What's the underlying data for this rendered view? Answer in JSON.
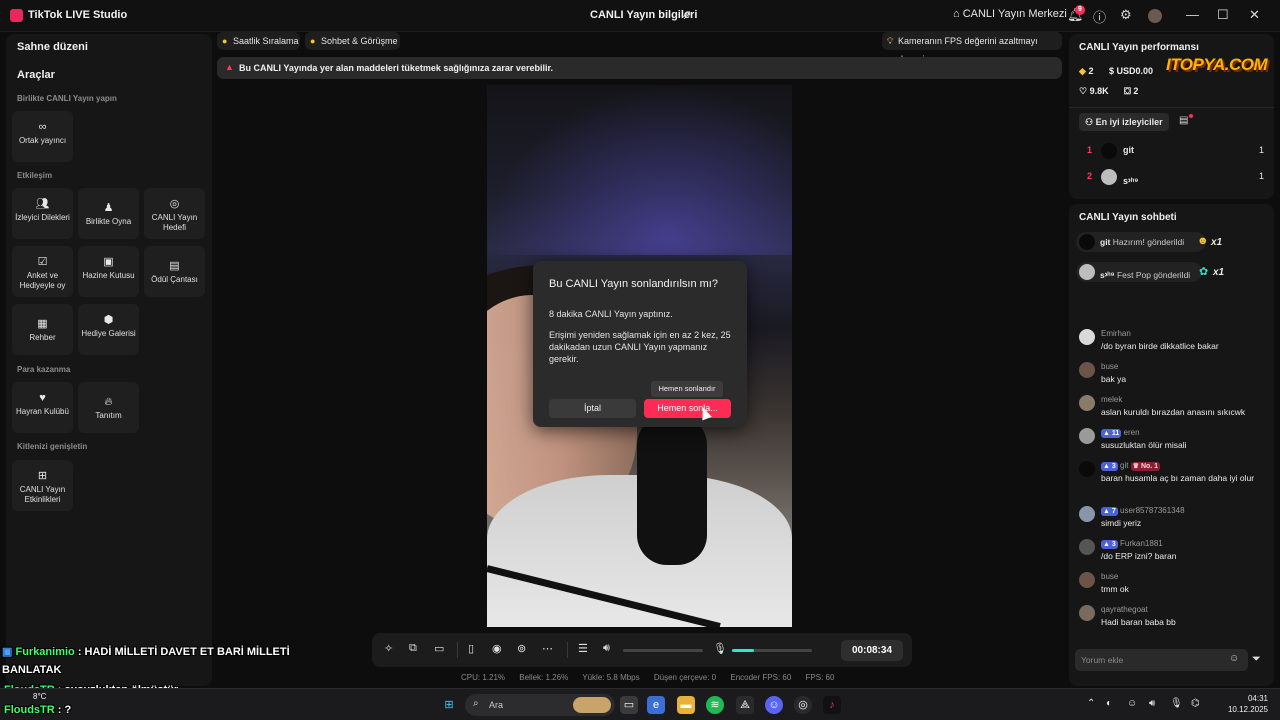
{
  "titlebar": {
    "app_name": "TikTok LIVE Studio",
    "center_title": "CANLI Yayın bilgileri",
    "center_link": "CANLI Yayın Merkezi",
    "notif_count": "9"
  },
  "left_panel": {
    "scene_title": "Sahne düzeni",
    "tools_title": "Araçlar",
    "sections": {
      "collab": "Birlikte CANLI Yayın yapın",
      "interaction": "Etkileşim",
      "monetize": "Para kazanma",
      "audience": "Kitlenizi genişletin"
    },
    "tools": {
      "cohost": "Ortak yayıncı",
      "viewer_requests": "İzleyici Dilekleri",
      "play_together": "Birlikte Oyna",
      "live_goal": "CANLI Yayın Hedefi",
      "poll": "Anket ve Hediyeyle oy",
      "treasure_box": "Hazine Kutusu",
      "reward_bag": "Ödül Çantası",
      "guide": "Rehber",
      "gift_gallery": "Hediye Galerisi",
      "fan_club": "Hayran Kulübü",
      "promotion": "Tanıtım",
      "live_events": "CANLI Yayın Etkinlikleri"
    }
  },
  "center": {
    "chip_ranking": "Saatlik Sıralama",
    "chip_chat": "Sohbet & Görüşme",
    "chip_fps": "Kameranın FPS değerini azaltmayı deneyin",
    "warning": "Bu CANLI Yayında yer alan maddeleri tüketmek sağlığınıza zarar verebilir."
  },
  "modal": {
    "title": "Bu CANLI Yayın sonlandırılsın mı?",
    "line1": "8 dakika CANLI Yayın yaptınız.",
    "line2": "Erişimi yeniden sağlamak için en az 2 kez, 25 dakikadan uzun CANLI Yayın yapmanız gerekir.",
    "cancel": "İptal",
    "end": "Hemen sonla...",
    "tooltip": "Hemen sonlandır"
  },
  "toolbar": {
    "timer": "00:08:34",
    "volume_level": 0.0,
    "mic_level": 0.28
  },
  "stats": {
    "cpu": "CPU:  1.21%",
    "memory": "Bellek:  1.26%",
    "upload": "Yükle:  5.8 Mbps",
    "dropped": "Düşen çerçeve:  0",
    "encoder_fps": "Encoder FPS:  60",
    "fps": "FPS:  60"
  },
  "performance": {
    "title": "CANLI Yayın performansı",
    "diamonds": "2",
    "usd": "USD0.00",
    "likes": "9.8K",
    "gifts": "2",
    "top_viewers_label": "En iyi izleyiciler",
    "ranking": [
      {
        "rank": "1",
        "name": "git",
        "count": "1"
      },
      {
        "rank": "2",
        "name": "s᠈ʰ⁹",
        "count": "1"
      }
    ]
  },
  "watermark": "ITOPYA.COM",
  "chat": {
    "title": "CANLI Yayın sohbeti",
    "gifts": [
      {
        "user": "git",
        "text": "Hazırım! gönderildi",
        "mult": "x1"
      },
      {
        "user": "s᠈ʰ⁹",
        "text": "Fest Pop gönderildi",
        "mult": "x1"
      }
    ],
    "messages": [
      {
        "user": "Emirhan",
        "level": "",
        "text": "/do byran birde dikkatlice bakar"
      },
      {
        "user": "buse",
        "level": "",
        "text": "bak ya"
      },
      {
        "user": "melek",
        "level": "",
        "text": "aslan kuruldı bırazdan anasını sıkıcwk"
      },
      {
        "user": "eren",
        "level": "11",
        "text": "susuzluktan ölür misali"
      },
      {
        "user": "git",
        "level": "3",
        "badge": "No. 1",
        "text": "baran husamla aç bı zaman daha iyi olur"
      },
      {
        "user": "user85787361348",
        "level": "7",
        "text": "simdi yeriz"
      },
      {
        "user": "Furkan1881",
        "level": "3",
        "text": "/do ERP izni? baran"
      },
      {
        "user": "buse",
        "level": "",
        "text": "tmm ok"
      },
      {
        "user": "qayrathegoat",
        "level": "",
        "text": "Hadi baran baba bb"
      }
    ],
    "comment_placeholder": "Yorum ekle"
  },
  "overlay": {
    "line1_name": "Furkanimio",
    "line1_text": ": HADİ MİLLETİ DAVET ET BARİ MİLLETİ",
    "line2_text": "BANLATAK",
    "line3_name": "FloudsTR",
    "line3_text": ": susuzluktan ölmüştür",
    "line4_name": "FloudsTR",
    "line4_text": ": ?"
  },
  "taskbar": {
    "search_placeholder": "Ara",
    "weather_temp": "8°C",
    "time": "04:31",
    "date": "10.12.2025"
  },
  "colors": {
    "accent": "#fe2c55",
    "mic_level": "#2ee6c9",
    "level_badge": "#4b63d6"
  }
}
